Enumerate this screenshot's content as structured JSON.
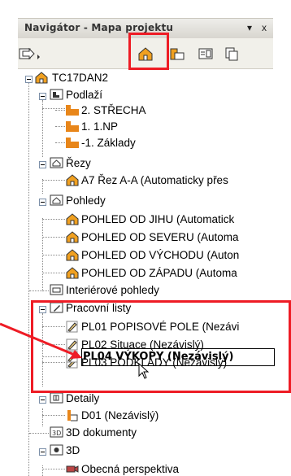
{
  "panel": {
    "title": "Navigátor - Mapa projektu",
    "menu_arrow": "▾",
    "close": "x"
  },
  "toolbar": {
    "buttons": [
      {
        "icon": "publisher-arrow-icon"
      },
      {
        "icon": "project-map-icon",
        "active": true
      },
      {
        "icon": "view-map-icon"
      },
      {
        "icon": "layout-book-icon"
      },
      {
        "icon": "publisher-sets-icon"
      }
    ]
  },
  "tree": {
    "root": "TC17DAN2",
    "podlazi": {
      "label": "Podlaží",
      "items": [
        "2. STŘECHA",
        "1. 1.NP",
        "-1. Základy"
      ]
    },
    "rezy": {
      "label": "Řezy",
      "items": [
        "A7 Řez A-A (Automaticky přes"
      ]
    },
    "pohledy": {
      "label": "Pohledy",
      "items": [
        "POHLED OD JIHU (Automatick",
        "POHLED OD SEVERU (Automa",
        "POHLED OD VÝCHODU (Auton",
        "POHLED OD ZÁPADU (Automa"
      ]
    },
    "interierove": "Interiérové pohledy",
    "pracovni_listy": {
      "label": "Pracovní listy",
      "items": [
        "PL01 POPISOVÉ POLE (Nezávi",
        "PL02 Situace (Nezávislý)",
        "PL03 PODKLADY (Nezávislý)",
        "PL04 VÝKOPY (Nezávislý)"
      ],
      "selected_index": 3
    },
    "detaily": {
      "label": "Detaily",
      "items": [
        "D01 (Nezávislý)"
      ]
    },
    "dokumenty3d": "3D dokumenty",
    "d3": {
      "label": "3D",
      "items": [
        "Obecná perspektiva"
      ]
    }
  },
  "colors": {
    "highlight": "#ee1c25",
    "folder_orange": "#e8861a",
    "house_orange": "#f0a020",
    "toolbar_bg": "#f1f0ea"
  }
}
